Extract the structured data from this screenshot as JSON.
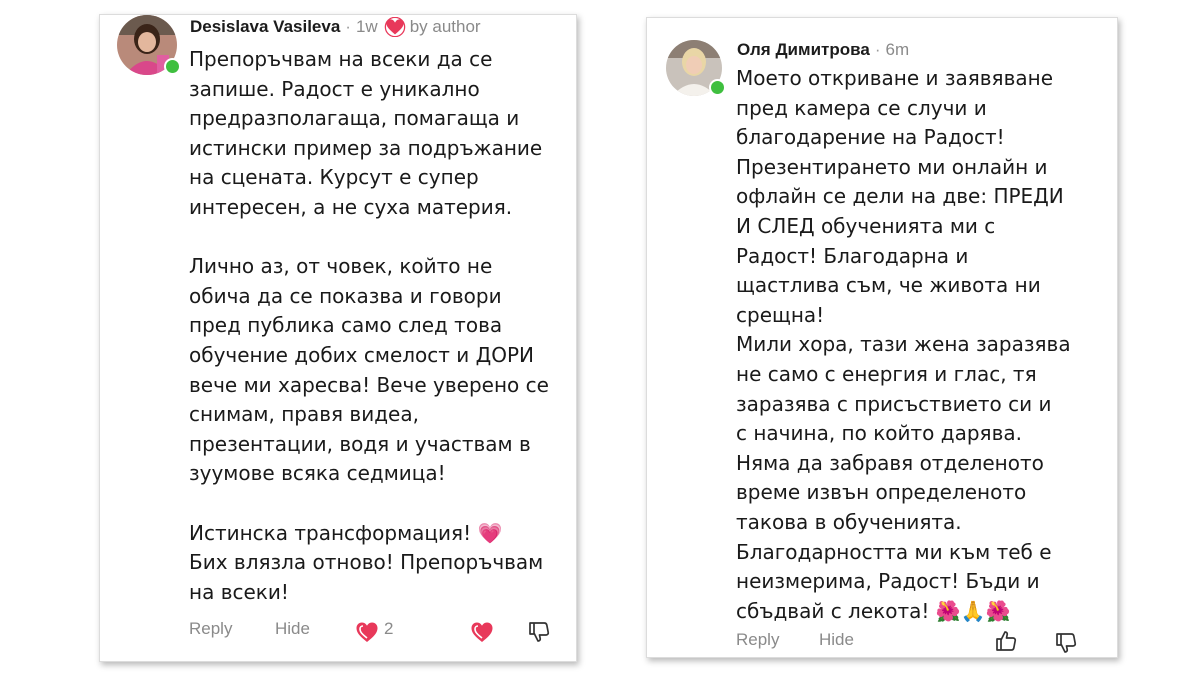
{
  "comments": [
    {
      "author": "Desislava Vasileva",
      "time": "1w",
      "badge": "by author",
      "text": "Препоръчвам на всеки да се\nзапише. Радост е уникално\nпредразполагаща, помагаща и\nистински пример за подръжание\nна сцената. Курсут е супер\nинтересен, а не суха материя.\n\nЛично аз, от човек, който не\nобича да се показва и говори\nпред публика само след това\nобучение добих смелост и ДОРИ\nвече ми харесва! Вече уверено се\nснимам, правя видеа,\nпрезентации, водя и участвам в\nзуумове всяка седмица!\n\nИстинска трансформация! 💗\nБих влязла отново! Препоръчвам\nна всеки!",
      "actions": {
        "reply": "Reply",
        "hide": "Hide",
        "like_count": "2"
      },
      "icons": [
        "heart-icon",
        "heart-icon",
        "thumbs-down-icon"
      ]
    },
    {
      "author": "Оля Димитрова",
      "time": "6m",
      "text": "Моето откриване и заявяване\nпред камера се случи и\nблагодарение на Радост!\nПрезентирането ми онлайн и\nофлайн се дели на две: ПРЕДИ\nИ СЛЕД обученията ми с\nРадост! Благодарна и\nщастлива съм, че живота ни\nсрещна!\nМили хора, тази жена заразява\nне само с енергия и глас, тя\nзаразява с присъствието си и\nс начина, по който дарява.\nНяма да забравя отделеното\nвреме извън определеното\nтакова в обученията.\nБлагодарността ми към теб е\nнеизмерима, Радост! Бъди и\nсбъдвай с лекота! 🌺🙏🌺",
      "actions": {
        "reply": "Reply",
        "hide": "Hide"
      },
      "icons": [
        "thumbs-up-icon",
        "thumbs-down-icon"
      ]
    }
  ],
  "colors": {
    "heart": "#e8385a",
    "online": "#3fbf3f",
    "muted": "#8a8a8a"
  }
}
